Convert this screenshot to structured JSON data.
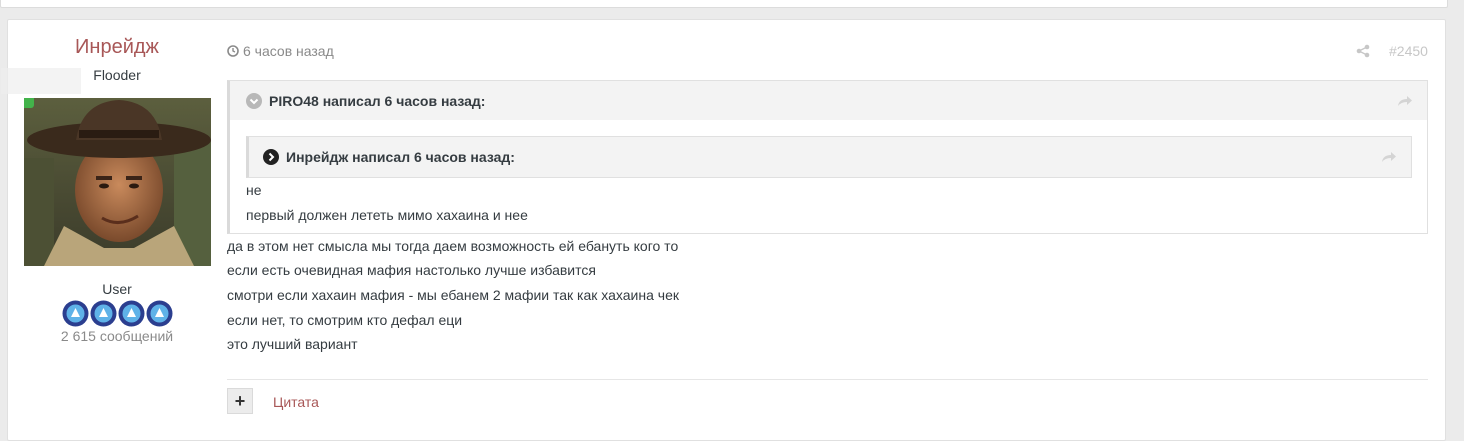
{
  "author": {
    "name": "Инрейдж",
    "title": "Flooder",
    "group": "User",
    "posts_count": "2 615 сообщений",
    "rank_pips": 4,
    "online": true,
    "colors": {
      "name": "#a85757",
      "online": "#43b34b"
    }
  },
  "post": {
    "time": "6 часов назад",
    "number": "#2450",
    "quote": {
      "citation": "PIRO48 написал 6 часов назад:",
      "nested": {
        "citation": "Инрейдж написал 6 часов назад:"
      },
      "lines": [
        "не",
        "первый должен лететь мимо хахаина и нее"
      ]
    },
    "body": [
      "да в этом нет смысла мы тогда даем возможность ей ебануть кого то",
      "если есть очевидная мафия настолько лучше избавится",
      "смотри если хахаин мафия - мы ебанем 2 мафии так как хахаина чек",
      "если нет, то смотрим кто дефал еци",
      "это лучший вариант"
    ]
  },
  "actions": {
    "multiquote_label": "+",
    "quote_label": "Цитата"
  },
  "icons": {
    "time": "clock-icon",
    "share": "share-icon",
    "quote_toggle": "chevron-down-circle-icon",
    "nested_toggle": "chevron-right-circle-icon",
    "reply": "reply-arrow-icon",
    "rank": "rank-pip-icon"
  }
}
